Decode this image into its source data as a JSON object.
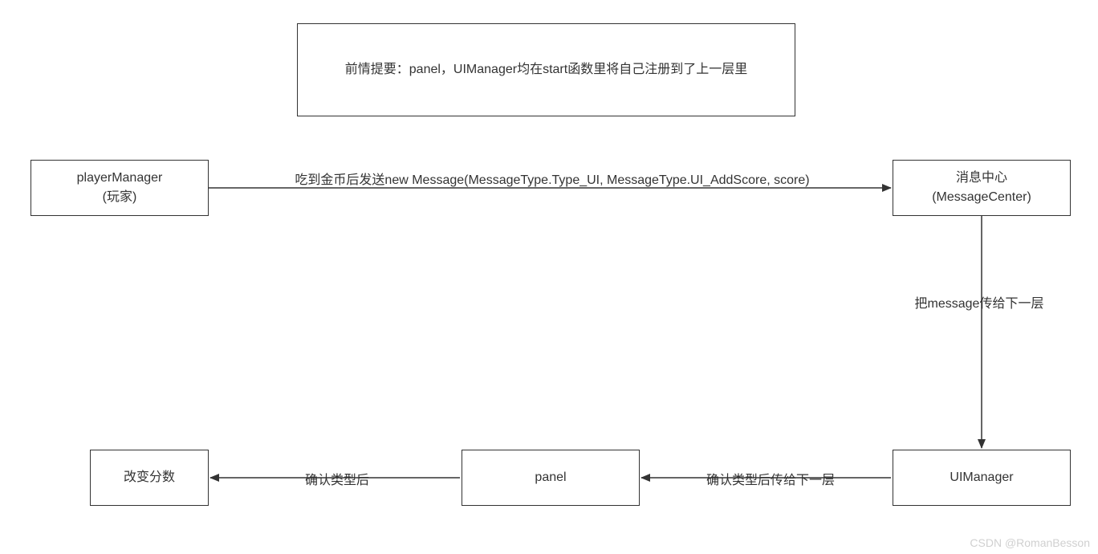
{
  "note_box": {
    "text": "前情提要：panel，UIManager均在start函数里将自己注册到了上一层里"
  },
  "nodes": {
    "player_manager": {
      "line1": "playerManager",
      "line2": "(玩家)"
    },
    "message_center": {
      "line1": "消息中心",
      "line2": "(MessageCenter)"
    },
    "ui_manager": {
      "text": "UIManager"
    },
    "panel": {
      "text": "panel"
    },
    "change_score": {
      "text": "改变分数"
    }
  },
  "edges": {
    "player_to_center": "吃到金币后发送new Message(MessageType.Type_UI, MessageType.UI_AddScore, score)",
    "center_to_uimanager": "把message传给下一层",
    "uimanager_to_panel": "确认类型后传给下一层",
    "panel_to_score": "确认类型后"
  },
  "watermark": "CSDN @RomanBesson"
}
